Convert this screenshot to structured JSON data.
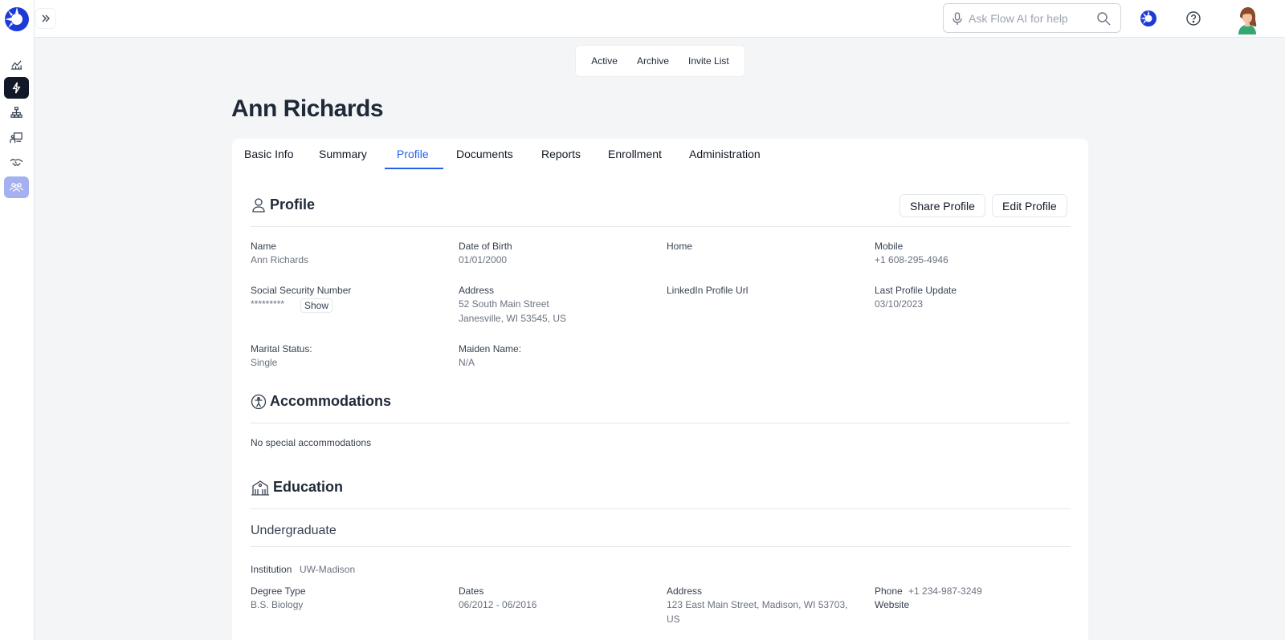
{
  "search": {
    "placeholder": "Ask Flow AI for help"
  },
  "segment": {
    "items": [
      "Active",
      "Archive",
      "Invite List"
    ]
  },
  "page": {
    "title": "Ann Richards"
  },
  "tabs": [
    "Basic Info",
    "Summary",
    "Profile",
    "Documents",
    "Reports",
    "Enrollment",
    "Administration"
  ],
  "active_tab": "Profile",
  "profile": {
    "heading": "Profile",
    "share_label": "Share Profile",
    "edit_label": "Edit Profile",
    "fields": {
      "name": {
        "label": "Name",
        "value": "Ann Richards"
      },
      "dob": {
        "label": "Date of Birth",
        "value": "01/01/2000"
      },
      "home": {
        "label": "Home",
        "value": ""
      },
      "mobile": {
        "label": "Mobile",
        "value": "+1 608-295-4946"
      },
      "ssn": {
        "label": "Social Security Number",
        "value": "*********",
        "show_label": "Show"
      },
      "address": {
        "label": "Address",
        "line1": "52 South Main Street",
        "line2": "Janesville, WI 53545, US"
      },
      "linkedin": {
        "label": "LinkedIn Profile Url",
        "value": ""
      },
      "last_update": {
        "label": "Last Profile Update",
        "value": "03/10/2023"
      },
      "marital": {
        "label": "Marital Status:",
        "value": "Single"
      },
      "maiden": {
        "label": "Maiden Name:",
        "value": "N/A"
      }
    }
  },
  "accommodations": {
    "heading": "Accommodations",
    "text": "No special accommodations"
  },
  "education": {
    "heading": "Education",
    "subheading": "Undergraduate",
    "institution_label": "Institution",
    "institution_value": "UW-Madison",
    "degree_label": "Degree Type",
    "degree_value": "B.S. Biology",
    "dates_label": "Dates",
    "dates_value": "06/2012 - 06/2016",
    "address_label": "Address",
    "address_line1": "123 East Main Street, Madison, WI 53703,",
    "address_line2": "US",
    "phone_label": "Phone",
    "phone_value": "+1 234-987-3249",
    "website_label": "Website"
  },
  "colors": {
    "accent": "#2563eb",
    "brand": "#1e3ad6",
    "nav_active_dark": "#111827",
    "nav_active_light": "#a5b0f0"
  },
  "icons": {
    "logo": "flow-logo-icon",
    "nav": [
      "analytics-icon",
      "lightning-icon",
      "org-chart-icon",
      "presentation-icon",
      "handshake-icon",
      "people-group-icon"
    ],
    "top": [
      "microphone-icon",
      "search-icon",
      "flow-ai-icon",
      "help-icon",
      "user-avatar"
    ]
  }
}
